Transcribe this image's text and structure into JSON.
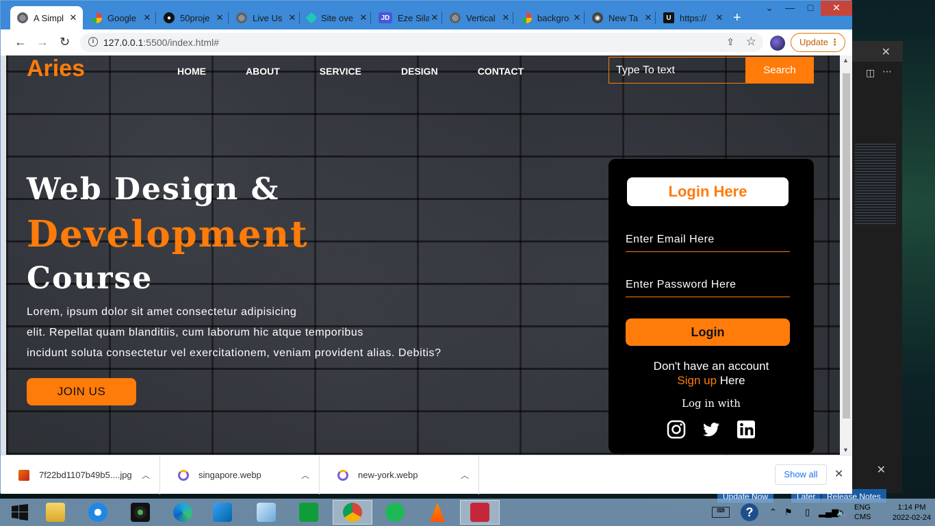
{
  "browser": {
    "tabs": [
      {
        "label": "A Simpl",
        "icon": "globe-icon",
        "active": true
      },
      {
        "label": "Google",
        "icon": "google-icon"
      },
      {
        "label": "50proje",
        "icon": "github-icon"
      },
      {
        "label": "Live Us",
        "icon": "globe-icon"
      },
      {
        "label": "Site ove",
        "icon": "netlify-icon"
      },
      {
        "label": "Eze Sila",
        "icon": "jd-icon"
      },
      {
        "label": "Vertical",
        "icon": "globe-icon"
      },
      {
        "label": "backgro",
        "icon": "google-icon"
      },
      {
        "label": "New Ta",
        "icon": "chrome-icon"
      },
      {
        "label": "https://",
        "icon": "u-icon"
      }
    ],
    "url_host": "127.0.0.1",
    "url_rest": ":5500/index.html#",
    "update_label": "Update"
  },
  "page": {
    "logo": "Aries",
    "nav": [
      "HOME",
      "ABOUT",
      "SERVICE",
      "DESIGN",
      "CONTACT"
    ],
    "search": {
      "placeholder": "Type To text",
      "button": "Search"
    },
    "hero": {
      "line1": "Web Design &",
      "line2": "Development",
      "line3": "Course",
      "para": [
        "Lorem, ipsum dolor sit amet consectetur adipisicing",
        "elit. Repellat quam blanditiis, cum laborum hic atque temporibus",
        "incidunt soluta consectetur vel exercitationem, veniam provident alias. Debitis?"
      ],
      "join": "JOIN US"
    },
    "login": {
      "title": "Login Here",
      "email_placeholder": "Enter Email Here",
      "password_placeholder": "Enter Password Here",
      "button": "Login",
      "no_account": "Don't have an account",
      "signup_link": "Sign up",
      "signup_suffix": " Here",
      "login_with": "Log in with",
      "socials": [
        "instagram-icon",
        "twitter-icon",
        "linkedin-icon"
      ]
    },
    "colors": {
      "accent": "#ff7b0a",
      "card": "#000000"
    }
  },
  "downloads": {
    "items": [
      "7f22bd1107b49b5....jpg",
      "singapore.webp",
      "new-york.webp"
    ],
    "show_all": "Show all"
  },
  "taskbar": {
    "apps": [
      "windows-start-icon",
      "file-explorer-icon",
      "internet-explorer-icon",
      "camera-app-icon",
      "edge-icon",
      "vscode-icon",
      "notepad-icon",
      "store-icon",
      "chrome-icon",
      "spotify-icon",
      "vlc-icon",
      "news-icon"
    ],
    "lang": "ENG",
    "lang2": "CMS",
    "time": "1:14 PM",
    "date": "2022-02-24"
  },
  "background_window": {
    "buttons": [
      "Update Now",
      "Later",
      "Release Notes"
    ]
  }
}
